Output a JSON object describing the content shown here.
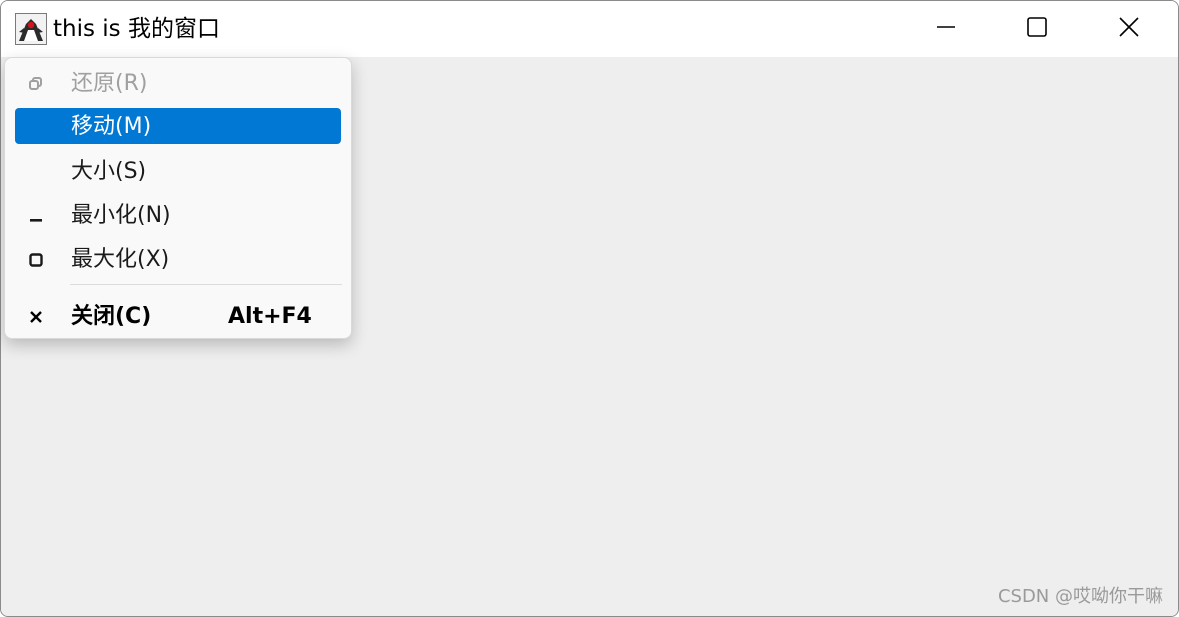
{
  "window": {
    "title": "this is 我的窗口"
  },
  "titlebar": {
    "app_icon": "java-duke-icon",
    "minimize_icon": "minimize-icon",
    "maximize_icon": "maximize-icon",
    "close_icon": "close-icon"
  },
  "system_menu": {
    "items": [
      {
        "label": "还原(R)",
        "icon": "restore-icon",
        "enabled": false,
        "selected": false,
        "bold": false,
        "accelerator": ""
      },
      {
        "label": "移动(M)",
        "icon": "",
        "enabled": true,
        "selected": true,
        "bold": false,
        "accelerator": ""
      },
      {
        "label": "大小(S)",
        "icon": "",
        "enabled": true,
        "selected": false,
        "bold": false,
        "accelerator": ""
      },
      {
        "label": "最小化(N)",
        "icon": "minimize-icon",
        "enabled": true,
        "selected": false,
        "bold": false,
        "accelerator": ""
      },
      {
        "label": "最大化(X)",
        "icon": "maximize-icon",
        "enabled": true,
        "selected": false,
        "bold": false,
        "accelerator": ""
      },
      {
        "label": "关闭(C)",
        "icon": "close-icon",
        "enabled": true,
        "selected": false,
        "bold": true,
        "accelerator": "Alt+F4"
      }
    ]
  },
  "watermark": {
    "text": "CSDN @哎呦你干嘛"
  },
  "colors": {
    "selection_accent": "#0078d4",
    "client_background": "#eeeeee",
    "menu_background": "#f9f9f9",
    "disabled_text": "#a0a0a0"
  }
}
